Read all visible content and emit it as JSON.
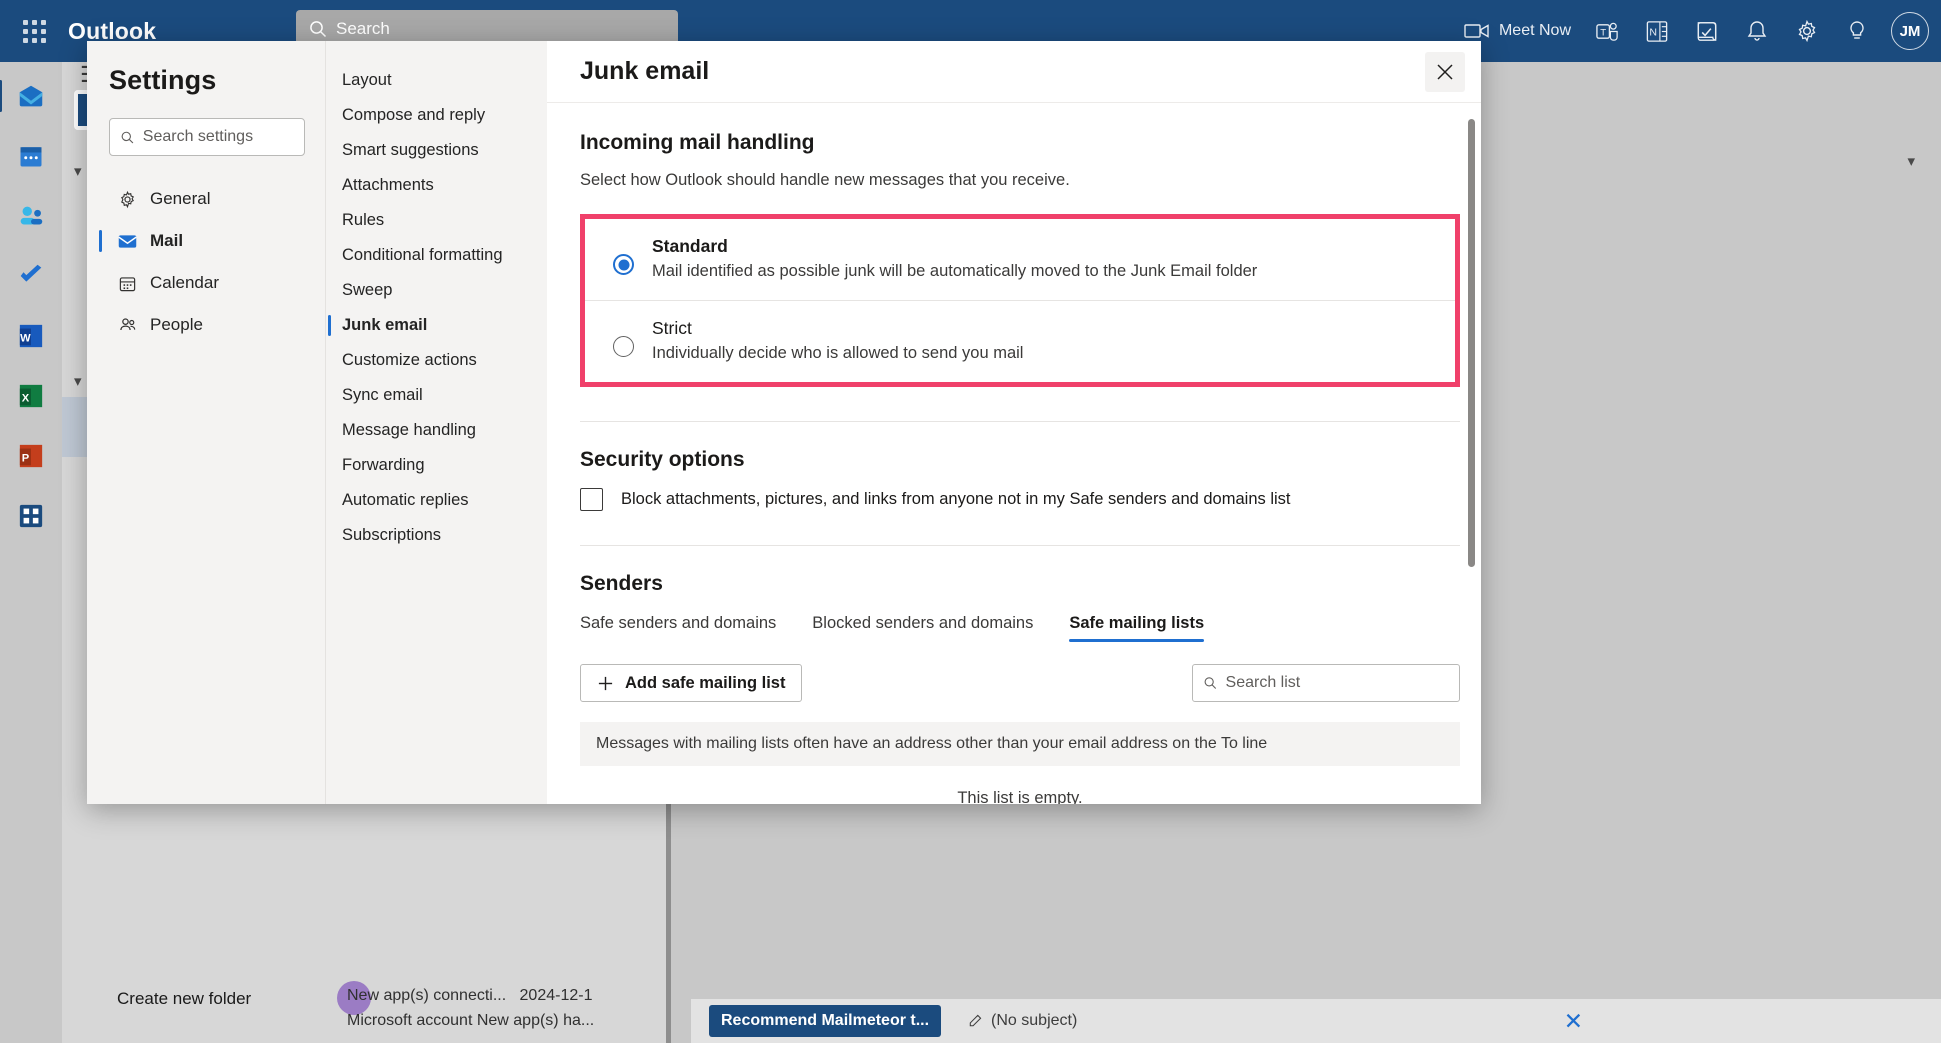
{
  "topbar": {
    "waffle_label": "App launcher",
    "brand": "Outlook",
    "search_placeholder": "Search",
    "meet_now": "Meet Now",
    "icons": {
      "video": "video-camera-icon",
      "teams": "teams-icon",
      "onenote": "onenote-icon",
      "todo": "to-do-icon",
      "bell": "notifications-bell-icon",
      "gear": "settings-gear-icon",
      "bulb": "tips-lightbulb-icon"
    },
    "avatar_initials": "JM"
  },
  "rail": {
    "items": [
      {
        "name": "mail",
        "label": "Mail",
        "active": true
      },
      {
        "name": "calendar",
        "label": "Calendar",
        "active": false
      },
      {
        "name": "people",
        "label": "People",
        "active": false
      },
      {
        "name": "todo",
        "label": "To Do",
        "active": false
      },
      {
        "name": "word",
        "label": "Word",
        "active": false
      },
      {
        "name": "excel",
        "label": "Excel",
        "active": false
      },
      {
        "name": "powerpoint",
        "label": "PowerPoint",
        "active": false
      },
      {
        "name": "all-apps",
        "label": "All apps",
        "active": false
      }
    ]
  },
  "background": {
    "create_new_folder": "Create new folder",
    "message_sender": "New app(s) connecti...",
    "message_date": "2024-12-1",
    "message_preview": "Microsoft account New app(s) ha...",
    "compose_recipient": "Recommend Mailmeteor t...",
    "compose_subject": "(No subject)"
  },
  "dialog": {
    "title": "Settings",
    "search_placeholder": "Search settings",
    "categories": [
      {
        "label": "General",
        "icon": "gear-icon",
        "active": false
      },
      {
        "label": "Mail",
        "icon": "envelope-icon",
        "active": true
      },
      {
        "label": "Calendar",
        "icon": "calendar-icon",
        "active": false
      },
      {
        "label": "People",
        "icon": "people-icon",
        "active": false
      }
    ],
    "subsections": [
      {
        "label": "Layout",
        "active": false
      },
      {
        "label": "Compose and reply",
        "active": false
      },
      {
        "label": "Smart suggestions",
        "active": false
      },
      {
        "label": "Attachments",
        "active": false
      },
      {
        "label": "Rules",
        "active": false
      },
      {
        "label": "Conditional formatting",
        "active": false
      },
      {
        "label": "Sweep",
        "active": false
      },
      {
        "label": "Junk email",
        "active": true
      },
      {
        "label": "Customize actions",
        "active": false
      },
      {
        "label": "Sync email",
        "active": false
      },
      {
        "label": "Message handling",
        "active": false
      },
      {
        "label": "Forwarding",
        "active": false
      },
      {
        "label": "Automatic replies",
        "active": false
      },
      {
        "label": "Subscriptions",
        "active": false
      }
    ],
    "pane": {
      "title": "Junk email",
      "close_label": "Close",
      "incoming": {
        "heading": "Incoming mail handling",
        "description": "Select how Outlook should handle new messages that you receive.",
        "highlight_color": "#f0406a",
        "options": [
          {
            "title": "Standard",
            "description": "Mail identified as possible junk will be automatically moved to the Junk Email folder",
            "selected": true
          },
          {
            "title": "Strict",
            "description": "Individually decide who is allowed to send you mail",
            "selected": false
          }
        ]
      },
      "security": {
        "heading": "Security options",
        "checkbox_label": "Block attachments, pictures, and links from anyone not in my Safe senders and domains list",
        "checked": false
      },
      "senders": {
        "heading": "Senders",
        "tabs": [
          {
            "label": "Safe senders and domains",
            "active": false
          },
          {
            "label": "Blocked senders and domains",
            "active": false
          },
          {
            "label": "Safe mailing lists",
            "active": true
          }
        ],
        "add_button": "Add safe mailing list",
        "search_placeholder": "Search list",
        "note": "Messages with mailing lists often have an address other than your email address on the To line",
        "empty_text": "This list is empty."
      }
    }
  }
}
